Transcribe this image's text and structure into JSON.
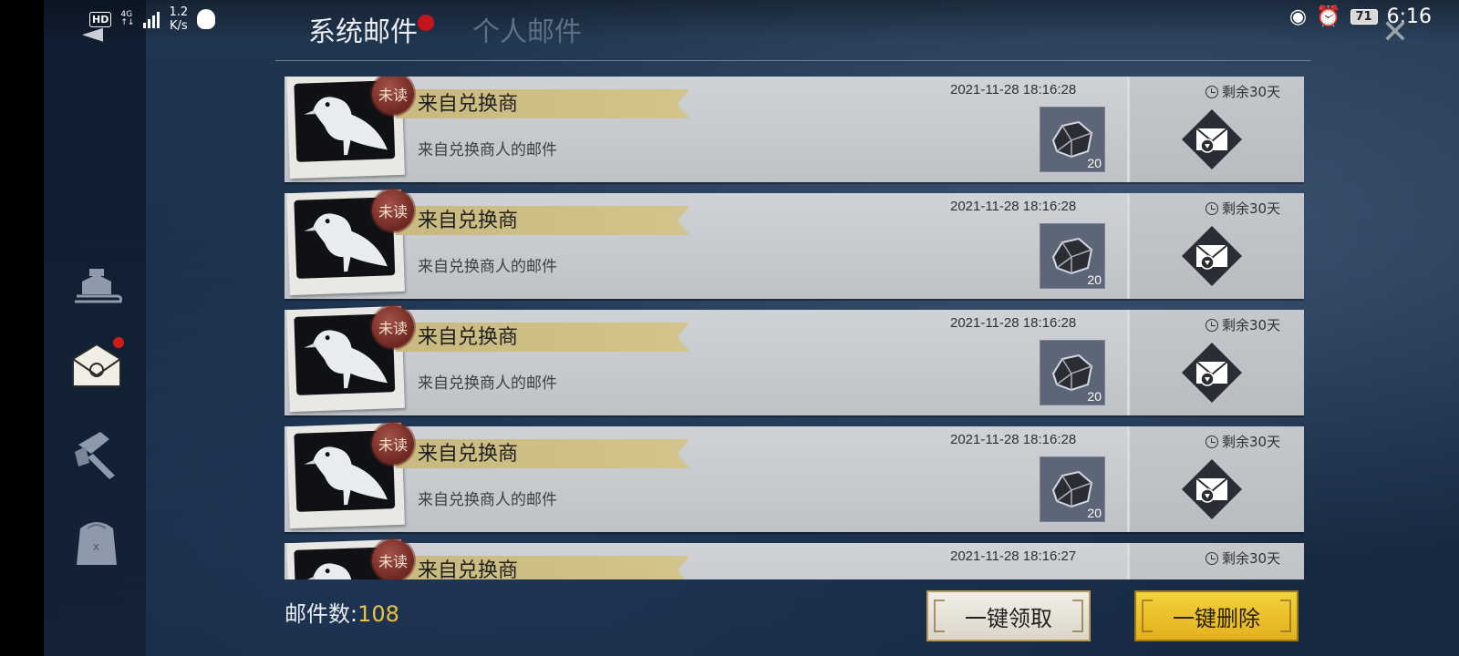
{
  "status_bar": {
    "hd": "HD",
    "network_top": "4G",
    "network_bottom": "↑↓",
    "speed_value": "1.2",
    "speed_unit": "K/s",
    "battery": "71",
    "time": "6:16"
  },
  "tabs": [
    {
      "label": "系统邮件",
      "active": true,
      "has_dot": true
    },
    {
      "label": "个人邮件",
      "active": false,
      "has_dot": false
    }
  ],
  "sidebar": {
    "items": [
      {
        "icon": "sled-icon",
        "active": false
      },
      {
        "icon": "mail-icon",
        "active": true,
        "has_dot": true
      },
      {
        "icon": "hammer-icon",
        "active": false
      },
      {
        "icon": "backpack-icon",
        "active": false
      }
    ]
  },
  "mails": [
    {
      "badge": "未读",
      "title": "来自兑换商",
      "subtitle": "来自兑换商人的邮件",
      "date": "2021-11-28 18:16:28",
      "reward_count": "20",
      "remaining": "剩余30天"
    },
    {
      "badge": "未读",
      "title": "来自兑换商",
      "subtitle": "来自兑换商人的邮件",
      "date": "2021-11-28 18:16:28",
      "reward_count": "20",
      "remaining": "剩余30天"
    },
    {
      "badge": "未读",
      "title": "来自兑换商",
      "subtitle": "来自兑换商人的邮件",
      "date": "2021-11-28 18:16:28",
      "reward_count": "20",
      "remaining": "剩余30天"
    },
    {
      "badge": "未读",
      "title": "来自兑换商",
      "subtitle": "来自兑换商人的邮件",
      "date": "2021-11-28 18:16:28",
      "reward_count": "20",
      "remaining": "剩余30天"
    },
    {
      "badge": "未读",
      "title": "来自兑换商",
      "subtitle": "",
      "date": "2021-11-28 18:16:27",
      "reward_count": "",
      "remaining": "剩余30天"
    }
  ],
  "footer": {
    "count_label": "邮件数:",
    "count_value": "108",
    "collect_all": "一键领取",
    "delete_all": "一键删除"
  },
  "colors": {
    "background": "#1b2e47",
    "accent_gold": "#e8c43a",
    "unread_seal": "#7e2f28",
    "ribbon": "#cfc088",
    "notification_dot": "#c4141c"
  }
}
